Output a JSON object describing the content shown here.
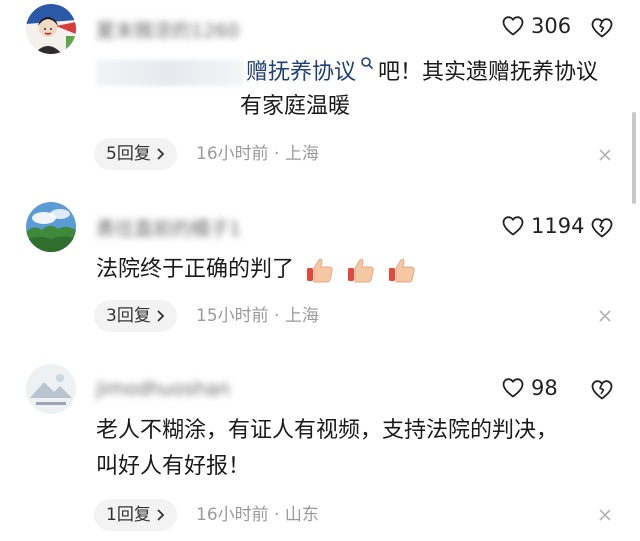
{
  "comments": [
    {
      "username": "夏末微凉的1260",
      "likes": "306",
      "lines": [
        "赠抚养协议",
        "吧！其实遗赠抚养协议",
        "有家庭温暖"
      ],
      "reply_label": "5回复",
      "time": "16小时前",
      "location": "上海"
    },
    {
      "username": "勇往直前的橘子1",
      "likes": "1194",
      "lines": [
        "法院终于正确的判了"
      ],
      "reply_label": "3回复",
      "time": "15小时前",
      "location": "上海"
    },
    {
      "username": "jimodhuoshan",
      "likes": "98",
      "lines": [
        "老人不糊涂，有证人有视频，支持法院的判决，",
        "叫好人有好报！"
      ],
      "reply_label": "1回复",
      "time": "16小时前",
      "location": "山东"
    }
  ],
  "separator": "·",
  "icons": {
    "like": "heart-outline-icon",
    "dislike": "broken-heart-icon",
    "close": "close-icon",
    "reply_chevron": "chevron-right-icon",
    "search_hint": "search-icon",
    "thumbs_up": "thumbs-up-emoji"
  },
  "colors": {
    "text": "#1a1a1a",
    "meta": "#9a9a9a",
    "reply_bg": "#f3f3f3",
    "link": "#1f3f7a"
  }
}
